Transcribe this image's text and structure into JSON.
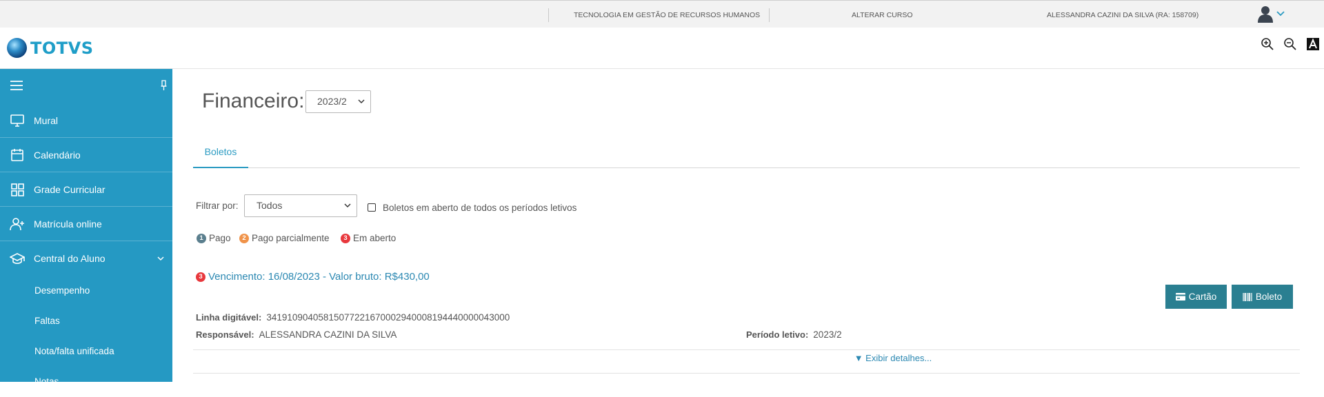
{
  "topbar": {
    "course": "TECNOLOGIA EM GESTÃO DE RECURSOS HUMANOS",
    "change_course": "ALTERAR CURSO",
    "user": "ALESSANDRA CAZINI DA SILVA (RA: 158709)"
  },
  "header": {
    "logo_text": "TOTVS",
    "tools": [
      "zoom-in-icon",
      "zoom-out-icon",
      "high-contrast-icon"
    ]
  },
  "sidebar": {
    "items": [
      {
        "label": "Mural",
        "icon": "monitor-icon"
      },
      {
        "label": "Calendário",
        "icon": "calendar-icon"
      },
      {
        "label": "Grade Curricular",
        "icon": "grid-icon"
      },
      {
        "label": "Matrícula online",
        "icon": "user-plus-icon"
      },
      {
        "label": "Central do Aluno",
        "icon": "graduation-cap-icon"
      }
    ],
    "subitems": [
      "Desempenho",
      "Faltas",
      "Nota/falta unificada",
      "Notas"
    ]
  },
  "main": {
    "title": "Financeiro:",
    "period_select": "2023/2",
    "tab": "Boletos",
    "filter_label": "Filtrar por:",
    "filter_value": "Todos",
    "checkbox_label": "Boletos em aberto de todos os períodos letivos",
    "legend": [
      {
        "num": "1",
        "label": "Pago",
        "color": "#5b7f8e"
      },
      {
        "num": "2",
        "label": "Pago parcialmente",
        "color": "#f0934a"
      },
      {
        "num": "3",
        "label": "Em aberto",
        "color": "#e8383d"
      }
    ],
    "boleto": {
      "status_num": "3",
      "title": "Vencimento: 16/08/2023 - Valor bruto: R$430,00",
      "card_button": "Cartão",
      "boleto_button": "Boleto",
      "linha_label": "Linha digitável:",
      "linha_value": "34191090405815077221670002940008194440000043000",
      "resp_label": "Responsável:",
      "resp_value": "ALESSANDRA CAZINI DA SILVA",
      "periodo_label": "Período letivo:",
      "periodo_value": "2023/2",
      "details": "▼ Exibir detalhes..."
    }
  },
  "colors": {
    "sidebar": "#2599c3",
    "accent": "#2b9bc2",
    "button": "#2a7f91"
  }
}
